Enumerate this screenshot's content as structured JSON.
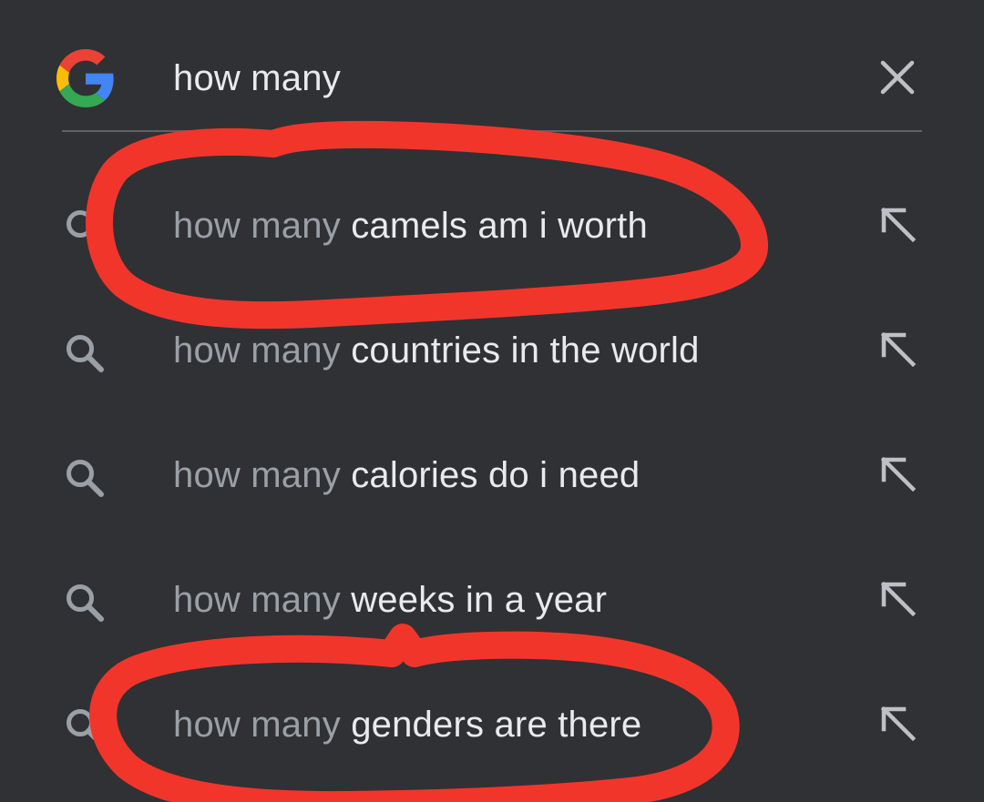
{
  "search": {
    "query": "how many",
    "logo": "google-g-logo",
    "clear_icon": "close-icon"
  },
  "suggestions": [
    {
      "prefix": "how many",
      "completion": " camels am i worth",
      "icon": "search-icon",
      "action_icon": "arrow-up-left-icon"
    },
    {
      "prefix": "how many",
      "completion": " countries in the world",
      "icon": "search-icon",
      "action_icon": "arrow-up-left-icon"
    },
    {
      "prefix": "how many",
      "completion": " calories do i need",
      "icon": "search-icon",
      "action_icon": "arrow-up-left-icon"
    },
    {
      "prefix": "how many",
      "completion": " weeks in a year",
      "icon": "search-icon",
      "action_icon": "arrow-up-left-icon"
    },
    {
      "prefix": "how many",
      "completion": " genders are there",
      "icon": "search-icon",
      "action_icon": "arrow-up-left-icon"
    }
  ],
  "colors": {
    "background": "#303134",
    "text_primary": "#e8eaed",
    "text_secondary": "#9aa0a6",
    "icon": "#9aa0a6",
    "annotation_marker": "#f2352b"
  }
}
